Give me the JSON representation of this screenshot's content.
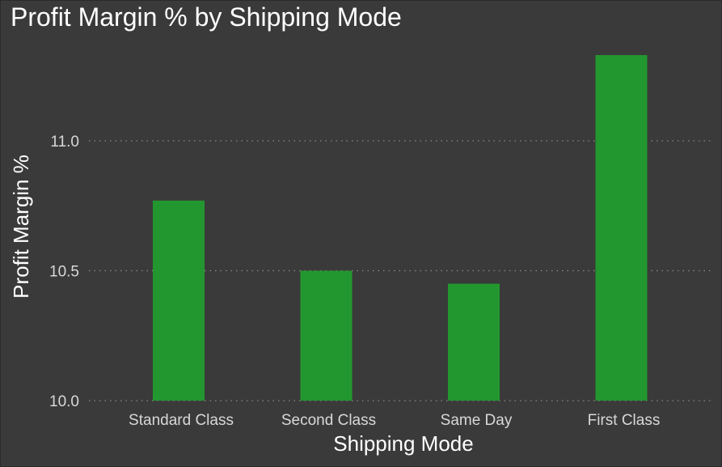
{
  "chart_data": {
    "type": "bar",
    "title": "Profit Margin % by Shipping Mode",
    "xlabel": "Shipping Mode",
    "ylabel": "Profit Margin %",
    "categories": [
      "Standard Class",
      "Second Class",
      "Same Day",
      "First Class"
    ],
    "values": [
      10.77,
      10.5,
      10.45,
      11.33
    ],
    "ylim": [
      10.0,
      11.4
    ],
    "yticks": [
      10.0,
      10.5,
      11.0
    ],
    "ytick_labels": [
      "10.0",
      "10.5",
      "11.0"
    ],
    "grid": true,
    "bar_color": "#23972f",
    "background_color": "#3a3a3a"
  }
}
